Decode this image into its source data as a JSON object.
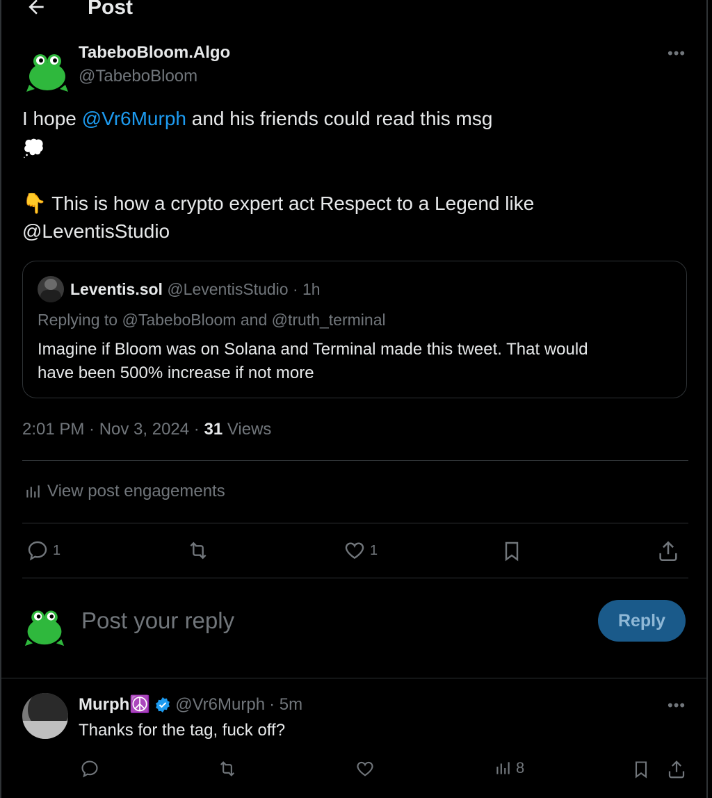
{
  "header": {
    "back_icon": "arrow-left-icon",
    "title": "Post"
  },
  "post": {
    "author_name": "TabeboBloom.Algo",
    "author_handle": "@TabeboBloom",
    "more_label": "•••",
    "text_prefix": "I hope ",
    "mention_1": "@Vr6Murph",
    "text_suffix": " and his friends could read this msg",
    "emoji_thought": "💭",
    "emoji_point": "👇",
    "line_2": " This is how a crypto expert act Respect to a Legend like",
    "mention_2": "@LeventisStudio",
    "quote": {
      "name": "Leventis.sol",
      "handle": "@LeventisStudio",
      "time": "· 1h",
      "replying_prefix": "Replying to ",
      "replying_1": "@TabeboBloom",
      "replying_and": " and ",
      "replying_2": "@truth_terminal",
      "text_line1": "Imagine if Bloom was on Solana and Terminal made this tweet. That would",
      "text_line2": "have been 500% increase if not more"
    },
    "timestamp": "2:01 PM · Nov 3, 2024 · ",
    "views_count": "31",
    "views_label": " Views",
    "engagements_label": "View post engagements",
    "actions": {
      "reply_count": "1",
      "repost_count": "",
      "like_count": "1"
    }
  },
  "composer": {
    "placeholder": "Post your reply",
    "button_label": "Reply"
  },
  "reply": {
    "name": "Murph☮️",
    "handle": "@Vr6Murph",
    "time": "· 5m",
    "text": "Thanks for the tag, fuck off?",
    "more_label": "•••",
    "views_count": "8"
  },
  "colors": {
    "accent": "#1d9bf0",
    "frog": "#2fb83d",
    "background": "#000000"
  }
}
